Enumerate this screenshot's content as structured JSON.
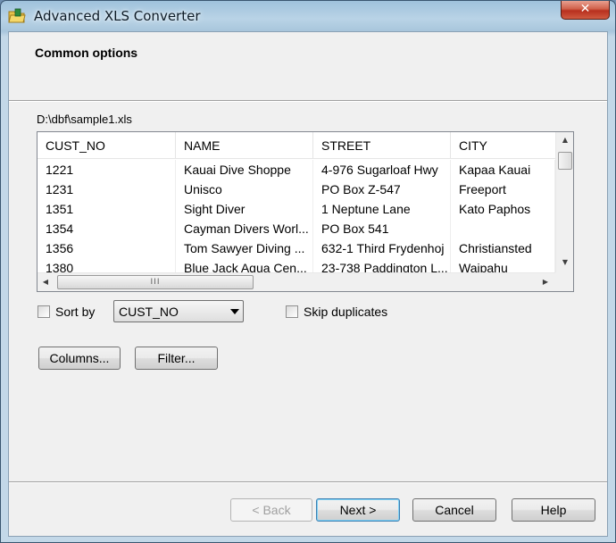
{
  "window": {
    "title": "Advanced XLS Converter",
    "close_glyph": "✕"
  },
  "page": {
    "title": "Common options",
    "file_path": "D:\\dbf\\sample1.xls"
  },
  "grid": {
    "columns": [
      "CUST_NO",
      "NAME",
      "STREET",
      "CITY"
    ],
    "rows": [
      [
        "1221",
        "Kauai Dive Shoppe",
        "4-976 Sugarloaf Hwy",
        "Kapaa Kauai"
      ],
      [
        "1231",
        "Unisco",
        "PO Box Z-547",
        "Freeport"
      ],
      [
        "1351",
        "Sight Diver",
        "1 Neptune Lane",
        "Kato Paphos"
      ],
      [
        "1354",
        "Cayman Divers Worl...",
        "PO Box 541",
        ""
      ],
      [
        "1356",
        "Tom Sawyer Diving ...",
        "632-1 Third Frydenhoj",
        "Christiansted"
      ],
      [
        "1380",
        "Blue Jack Aqua Cen...",
        "23-738 Paddington L...",
        "Waipahu"
      ]
    ],
    "scroll_up_glyph": "▲",
    "scroll_down_glyph": "▼",
    "scroll_left_glyph": "◀",
    "scroll_right_glyph": "▶",
    "thumb_grip": "III"
  },
  "options": {
    "sort_by_label": "Sort by",
    "sort_by_checked": false,
    "sort_field": "CUST_NO",
    "skip_duplicates_label": "Skip duplicates",
    "skip_duplicates_checked": false
  },
  "buttons": {
    "columns": "Columns...",
    "filter": "Filter...",
    "back": "< Back",
    "next": "Next >",
    "cancel": "Cancel",
    "help": "Help"
  },
  "icons": {
    "app": "folder-icon"
  },
  "colors": {
    "close_button": "#c8402a",
    "default_button_border": "#3c7fb1"
  }
}
